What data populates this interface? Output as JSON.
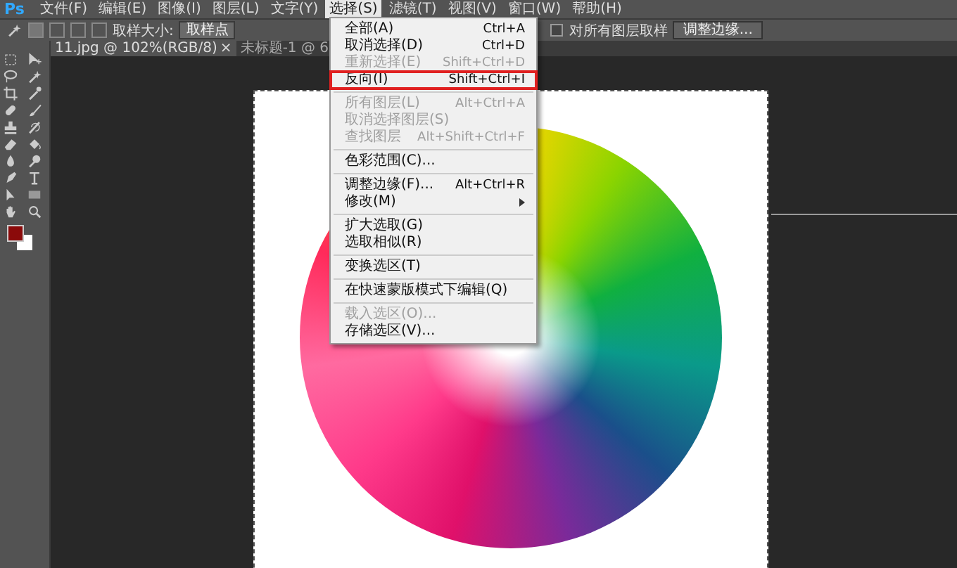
{
  "app": {
    "logo": "Ps"
  },
  "menubar": [
    {
      "label": "文件(F)",
      "selected": false
    },
    {
      "label": "编辑(E)",
      "selected": false
    },
    {
      "label": "图像(I)",
      "selected": false
    },
    {
      "label": "图层(L)",
      "selected": false
    },
    {
      "label": "文字(Y)",
      "selected": false
    },
    {
      "label": "选择(S)",
      "selected": true
    },
    {
      "label": "滤镜(T)",
      "selected": false
    },
    {
      "label": "视图(V)",
      "selected": false
    },
    {
      "label": "窗口(W)",
      "selected": false
    },
    {
      "label": "帮助(H)",
      "selected": false
    }
  ],
  "options_bar": {
    "sample_size_label": "取样大小:",
    "sample_size_value": "取样点",
    "all_layers": {
      "label": "对所有图层取样",
      "checked": false
    },
    "refine_button": "调整边缘..."
  },
  "tabs": [
    {
      "label": "11.jpg @ 102%(RGB/8)",
      "close": "×",
      "selected": true
    },
    {
      "label": "未标题-1 @ 6",
      "selected": false
    }
  ],
  "menu": {
    "items": [
      {
        "kind": "item",
        "label": "全部(A)",
        "shortcut": "Ctrl+A",
        "disabled": false,
        "highlighted": false
      },
      {
        "kind": "item",
        "label": "取消选择(D)",
        "shortcut": "Ctrl+D",
        "disabled": false,
        "highlighted": false
      },
      {
        "kind": "item",
        "label": "重新选择(E)",
        "shortcut": "Shift+Ctrl+D",
        "disabled": true,
        "highlighted": false
      },
      {
        "kind": "item",
        "label": "反向(I)",
        "shortcut": "Shift+Ctrl+I",
        "disabled": false,
        "highlighted": true
      },
      {
        "kind": "separator"
      },
      {
        "kind": "item",
        "label": "所有图层(L)",
        "shortcut": "Alt+Ctrl+A",
        "disabled": true,
        "highlighted": false
      },
      {
        "kind": "item",
        "label": "取消选择图层(S)",
        "disabled": true,
        "highlighted": false
      },
      {
        "kind": "item",
        "label": "查找图层",
        "shortcut": "Alt+Shift+Ctrl+F",
        "disabled": true,
        "highlighted": false
      },
      {
        "kind": "separator"
      },
      {
        "kind": "item",
        "label": "色彩范围(C)...",
        "disabled": false,
        "highlighted": false
      },
      {
        "kind": "separator"
      },
      {
        "kind": "item",
        "label": "调整边缘(F)...",
        "shortcut": "Alt+Ctrl+R",
        "disabled": false,
        "highlighted": false
      },
      {
        "kind": "submenu",
        "label": "修改(M)",
        "disabled": false,
        "highlighted": false
      },
      {
        "kind": "separator"
      },
      {
        "kind": "item",
        "label": "扩大选取(G)",
        "disabled": false,
        "highlighted": false
      },
      {
        "kind": "item",
        "label": "选取相似(R)",
        "disabled": false,
        "highlighted": false
      },
      {
        "kind": "separator"
      },
      {
        "kind": "item",
        "label": "变换选区(T)",
        "disabled": false,
        "highlighted": false
      },
      {
        "kind": "separator"
      },
      {
        "kind": "item",
        "label": "在快速蒙版模式下编辑(Q)",
        "disabled": false,
        "highlighted": false
      },
      {
        "kind": "separator"
      },
      {
        "kind": "item",
        "label": "载入选区(O)...",
        "disabled": true,
        "highlighted": false
      },
      {
        "kind": "item",
        "label": "存储选区(V)...",
        "disabled": false,
        "highlighted": false
      }
    ]
  }
}
